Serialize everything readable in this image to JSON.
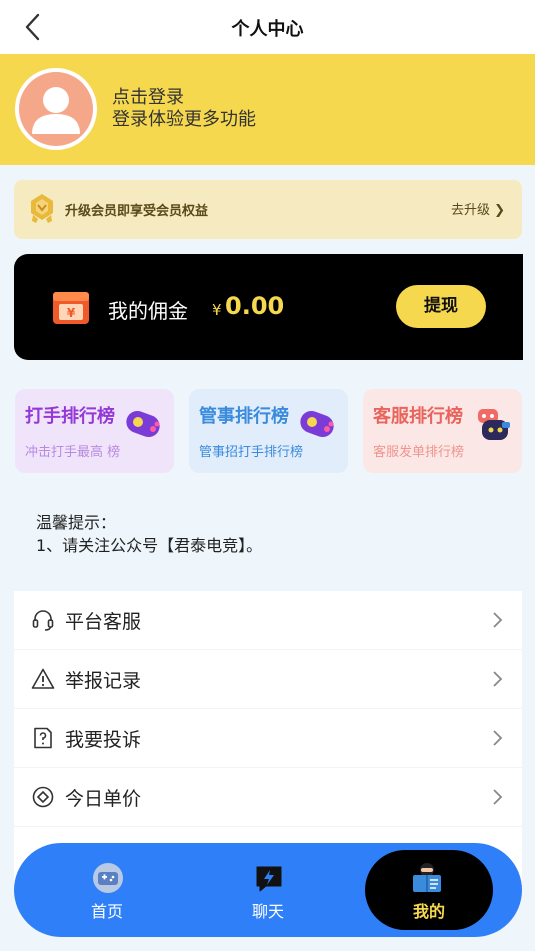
{
  "nav": {
    "title": "个人中心",
    "back_icon": "chevron-left-icon"
  },
  "profile": {
    "login": "点击登录",
    "subtitle": "登录体验更多功能",
    "avatar_icon": "user-avatar-icon"
  },
  "vip": {
    "text": "升级会员即享受会员权益",
    "upgrade": "去升级",
    "upgrade_arrow": "❯",
    "badge_icon": "vip-badge-icon"
  },
  "wallet": {
    "label": "我的佣金",
    "currency": "¥",
    "amount": "0.00",
    "withdraw": "提现",
    "icon": "wallet-icon"
  },
  "rankings": [
    {
      "title": "打手排行榜",
      "subtitle": "冲击打手最高 榜",
      "icon": "gamepad-icon"
    },
    {
      "title": "管事排行榜",
      "subtitle": "管事招打手排行榜",
      "icon": "gamepad-icon"
    },
    {
      "title": "客服排行榜",
      "subtitle": "客服发单排行榜",
      "icon": "robot-icon"
    }
  ],
  "tip": {
    "title": "温馨提示：",
    "line1": "1、请关注公众号【君泰电竞】。"
  },
  "menu": [
    {
      "label": "平台客服",
      "icon": "headset-icon"
    },
    {
      "label": "举报记录",
      "icon": "warning-icon"
    },
    {
      "label": "我要投诉",
      "icon": "complaint-icon"
    },
    {
      "label": "今日单价",
      "icon": "price-icon"
    }
  ],
  "tabs": [
    {
      "label": "首页",
      "icon": "game-console-icon"
    },
    {
      "label": "聊天",
      "icon": "chat-bolt-icon"
    },
    {
      "label": "我的",
      "icon": "reader-icon",
      "active": true
    }
  ],
  "colors": {
    "yellow": "#f6d84f",
    "blue": "#2f80f8",
    "black": "#000000"
  }
}
